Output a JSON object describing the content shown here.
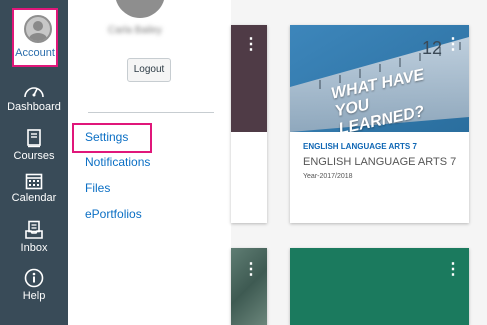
{
  "nav": {
    "items": [
      {
        "label": "Account",
        "icon": "account-avatar-icon"
      },
      {
        "label": "Dashboard",
        "icon": "dashboard-gauge-icon"
      },
      {
        "label": "Courses",
        "icon": "courses-book-icon"
      },
      {
        "label": "Calendar",
        "icon": "calendar-icon"
      },
      {
        "label": "Inbox",
        "icon": "inbox-icon"
      },
      {
        "label": "Help",
        "icon": "help-icon"
      }
    ],
    "background": "#394b58",
    "highlight": "#e0177a"
  },
  "tray": {
    "user_name": "Carla Bailey",
    "logout_label": "Logout",
    "links": [
      "Settings",
      "Notifications",
      "Files",
      "ePortfolios"
    ],
    "link_color": "#0b6fc4"
  },
  "cards": {
    "card1": {
      "color": "#4f3b46"
    },
    "card2": {
      "image_text": "WHAT HAVE YOU LEARNED?",
      "ruler_number": "12",
      "title": "ENGLISH LANGUAGE ARTS 7",
      "subtitle": "ENGLISH LANGUAGE ARTS 7",
      "term": "Year-2017/2018"
    },
    "card3": {
      "color": "#4f6a63"
    },
    "card4": {
      "color": "#1b7a5e"
    },
    "menu_icon": "⋮"
  }
}
